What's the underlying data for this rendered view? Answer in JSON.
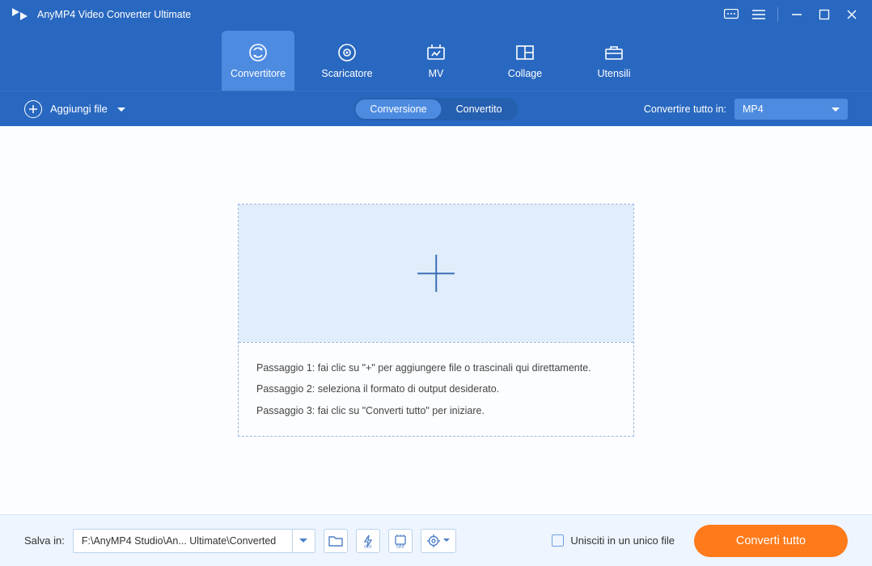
{
  "titlebar": {
    "app_name": "AnyMP4 Video Converter Ultimate"
  },
  "tabs": {
    "items": [
      {
        "label": "Convertitore"
      },
      {
        "label": "Scaricatore"
      },
      {
        "label": "MV"
      },
      {
        "label": "Collage"
      },
      {
        "label": "Utensili"
      }
    ]
  },
  "subbar": {
    "add_file": "Aggiungi file",
    "seg_conversion": "Conversione",
    "seg_converted": "Convertito",
    "convert_all_label": "Convertire tutto in:",
    "format_selected": "MP4"
  },
  "dropzone": {
    "step1": "Passaggio 1: fai clic su \"+\" per aggiungere file o trascinali qui direttamente.",
    "step2": "Passaggio 2: seleziona il formato di output desiderato.",
    "step3": "Passaggio 3: fai clic su \"Converti tutto\" per iniziare."
  },
  "bottombar": {
    "save_to_label": "Salva in:",
    "path": "F:\\AnyMP4 Studio\\An... Ultimate\\Converted",
    "merge_label": "Unisciti in un unico file",
    "convert_all_btn": "Converti tutto"
  }
}
